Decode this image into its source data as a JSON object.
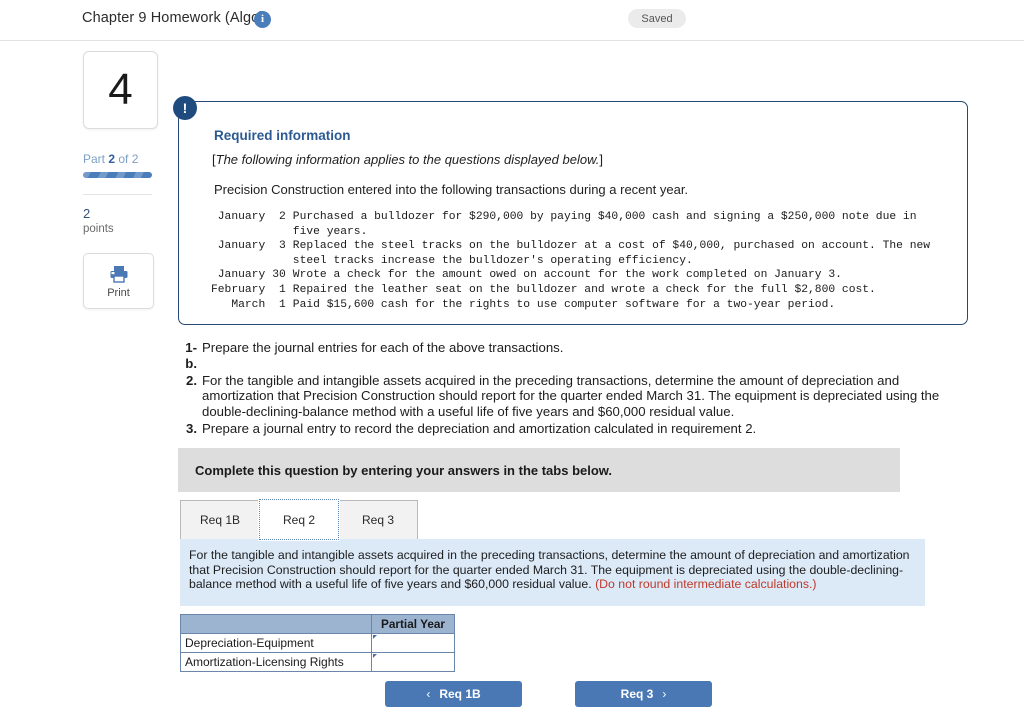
{
  "header": {
    "title": "Chapter 9 Homework (Algo)",
    "info_icon": "info-icon",
    "saved_label": "Saved"
  },
  "sidebar": {
    "question_number": "4",
    "part_prefix": "Part ",
    "part_current": "2",
    "part_suffix": " of 2",
    "points_value": "2",
    "points_label": "points",
    "print_label": "Print",
    "print_icon": "printer-icon"
  },
  "required_info": {
    "alert_icon": "alert-exclamation-icon",
    "title": "Required information",
    "bracket_open": "[",
    "italic_note": "The following information applies to the questions displayed below.",
    "bracket_close": "]",
    "intro": "Precision Construction entered into the following transactions during a recent year.",
    "transactions": [
      {
        "month": "January",
        "day": "2",
        "description": "Purchased a bulldozer for $290,000 by paying $40,000 cash and signing a $250,000 note due in\nfive years."
      },
      {
        "month": "January",
        "day": "3",
        "description": "Replaced the steel tracks on the bulldozer at a cost of $40,000, purchased on account. The new\nsteel tracks increase the bulldozer's operating efficiency."
      },
      {
        "month": "January",
        "day": "30",
        "description": "Wrote a check for the amount owed on account for the work completed on January 3."
      },
      {
        "month": "February",
        "day": "1",
        "description": "Repaired the leather seat on the bulldozer and wrote a check for the full $2,800 cost."
      },
      {
        "month": "March",
        "day": "1",
        "description": "Paid $15,600 cash for the rights to use computer software for a two-year period."
      }
    ]
  },
  "requirements": [
    {
      "num": "1-b.",
      "text": "Prepare the journal entries for each of the above transactions."
    },
    {
      "num": "2.",
      "text": "For the tangible and intangible assets acquired in the preceding transactions, determine the amount of depreciation and amortization that Precision Construction should report for the quarter ended March 31. The equipment is depreciated using the double-declining-balance method with a useful life of five years and $60,000 residual value."
    },
    {
      "num": "3.",
      "text": "Prepare a journal entry to record the depreciation and amortization calculated in requirement 2."
    }
  ],
  "banner": {
    "text": "Complete this question by entering your answers in the tabs below."
  },
  "tabs": [
    {
      "label": "Req 1B",
      "active": false
    },
    {
      "label": "Req 2",
      "active": true
    },
    {
      "label": "Req 3",
      "active": false
    }
  ],
  "instruction": {
    "main": "For the tangible and intangible assets acquired in the preceding transactions, determine the amount of depreciation and amortization that Precision Construction should report for the quarter ended March 31. The equipment is depreciated using the double-declining-balance method with a useful life of five years and $60,000 residual value. ",
    "red_note": "(Do not round intermediate calculations.)"
  },
  "answer_table": {
    "col_blank": "",
    "col_partial_year": "Partial Year",
    "rows": [
      {
        "label": "Depreciation-Equipment",
        "value": ""
      },
      {
        "label": "Amortization-Licensing Rights",
        "value": ""
      }
    ]
  },
  "nav": {
    "prev_label": "Req 1B",
    "prev_chevron": "‹",
    "next_label": "Req 3",
    "next_chevron": "›"
  },
  "colors": {
    "accent_blue": "#4a78b5",
    "panel_border": "#254a75",
    "instruction_bg": "#dce9f7",
    "table_header": "#9db4d1",
    "red_note": "#c0392b",
    "banner_bg": "#dddddd"
  }
}
